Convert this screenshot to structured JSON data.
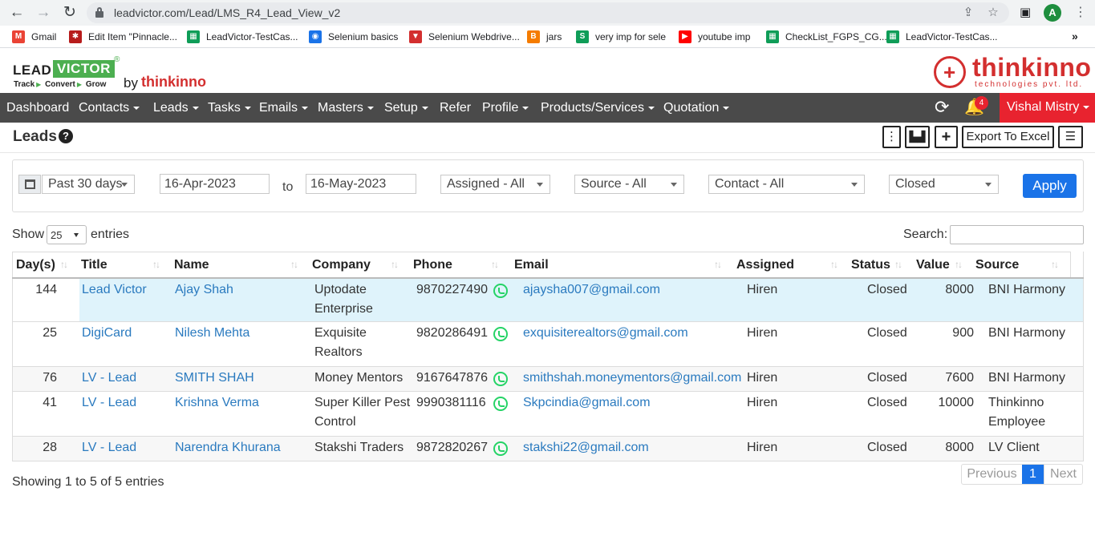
{
  "browser": {
    "url": "leadvictor.com/Lead/LMS_R4_Lead_View_v2",
    "profile_initial": "A",
    "bookmarks": [
      {
        "label": "Gmail",
        "icon": "gmail-icon",
        "color": "#ea4335"
      },
      {
        "label": "Edit Item \"Pinnacle...",
        "icon": "settings-icon",
        "color": "#b71c1c"
      },
      {
        "label": "LeadVictor-TestCas...",
        "icon": "sheets-icon",
        "color": "#0f9d58"
      },
      {
        "label": "Selenium basics",
        "icon": "chrome-icon",
        "color": "#1a73e8"
      },
      {
        "label": "Selenium Webdrive...",
        "icon": "tri-icon",
        "color": "#d32f2f"
      },
      {
        "label": "jars",
        "icon": "blogger-icon",
        "color": "#f57c00"
      },
      {
        "label": "very imp for sele",
        "icon": "s-icon",
        "color": "#0f9d58"
      },
      {
        "label": "youtube imp",
        "icon": "youtube-icon",
        "color": "#ff0000"
      },
      {
        "label": "CheckList_FGPS_CG...",
        "icon": "sheets-icon",
        "color": "#0f9d58"
      },
      {
        "label": "LeadVictor-TestCas...",
        "icon": "sheets-icon",
        "color": "#0f9d58"
      }
    ],
    "more": "»"
  },
  "brand": {
    "lead": "LEAD",
    "victor": "VICTOR",
    "reg": "®",
    "tag1": "Track",
    "tag2": "Convert",
    "tag3": "Grow",
    "by": "by",
    "thinkinno": "thinkinno",
    "company": "thinkinno",
    "company_sub": "technologies pvt. ltd."
  },
  "nav": {
    "items": [
      {
        "label": "Dashboard",
        "dropdown": false
      },
      {
        "label": "Contacts",
        "dropdown": true
      },
      {
        "label": "Leads",
        "dropdown": true
      },
      {
        "label": "Tasks",
        "dropdown": true
      },
      {
        "label": "Emails",
        "dropdown": true
      },
      {
        "label": "Masters",
        "dropdown": true
      },
      {
        "label": "Setup",
        "dropdown": true
      },
      {
        "label": "Refer",
        "dropdown": false
      },
      {
        "label": "Profile",
        "dropdown": true
      },
      {
        "label": "Products/Services",
        "dropdown": true
      },
      {
        "label": "Quotation",
        "dropdown": true
      }
    ],
    "notification_count": "4",
    "user_name": "Vishal Mistry"
  },
  "page": {
    "title": "Leads",
    "help": "?",
    "export_label": "Export To Excel"
  },
  "filters": {
    "period": "Past 30 days",
    "from_date": "16-Apr-2023",
    "to_label": "to",
    "to_date": "16-May-2023",
    "assigned": "Assigned - All",
    "source": "Source - All",
    "contact": "Contact - All",
    "status": "Closed",
    "apply_label": "Apply"
  },
  "table_controls": {
    "show_label": "Show",
    "page_length": "25",
    "entries_label": "entries",
    "search_label": "Search:",
    "search_value": ""
  },
  "table": {
    "columns": [
      "Day(s)",
      "Title",
      "Name",
      "Company",
      "Phone",
      "Email",
      "Assigned",
      "Status",
      "Value",
      "Source"
    ],
    "rows": [
      {
        "days": "144",
        "title": "Lead Victor",
        "name": "Ajay Shah",
        "company": [
          "Uptodate",
          "Enterprise"
        ],
        "phone": "9870227490",
        "email": "ajaysha007@gmail.com",
        "assigned": "Hiren",
        "status": "Closed",
        "value": "8000",
        "source": [
          "BNI Harmony"
        ]
      },
      {
        "days": "25",
        "title": "DigiCard",
        "name": "Nilesh Mehta",
        "company": [
          "Exquisite",
          "Realtors"
        ],
        "phone": "9820286491",
        "email": "exquisiterealtors@gmail.com",
        "assigned": "Hiren",
        "status": "Closed",
        "value": "900",
        "source": [
          "BNI Harmony"
        ]
      },
      {
        "days": "76",
        "title": "LV - Lead",
        "name": "SMITH SHAH",
        "company": [
          "Money Mentors"
        ],
        "phone": "9167647876",
        "email": "smithshah.moneymentors@gmail.com",
        "assigned": "Hiren",
        "status": "Closed",
        "value": "7600",
        "source": [
          "BNI Harmony"
        ]
      },
      {
        "days": "41",
        "title": "LV - Lead",
        "name": "Krishna Verma",
        "company": [
          "Super Killer Pest",
          "Control"
        ],
        "phone": "9990381116",
        "email": "Skpcindia@gmail.com",
        "assigned": "Hiren",
        "status": "Closed",
        "value": "10000",
        "source": [
          "Thinkinno",
          "Employee"
        ]
      },
      {
        "days": "28",
        "title": "LV - Lead",
        "name": "Narendra Khurana",
        "company": [
          "Stakshi Traders"
        ],
        "phone": "9872820267",
        "email": "stakshi22@gmail.com",
        "assigned": "Hiren",
        "status": "Closed",
        "value": "8000",
        "source": [
          "LV Client"
        ]
      }
    ]
  },
  "footer": {
    "info": "Showing 1 to 5 of 5 entries",
    "previous": "Previous",
    "current_page": "1",
    "next": "Next"
  },
  "colors": {
    "nav_bg": "#4a4a4a",
    "user_bg": "#e8232f",
    "link": "#2a7abf",
    "primary": "#1a73e8",
    "highlight_row": "#dff3fb",
    "striped_row": "#f7f7f7"
  }
}
